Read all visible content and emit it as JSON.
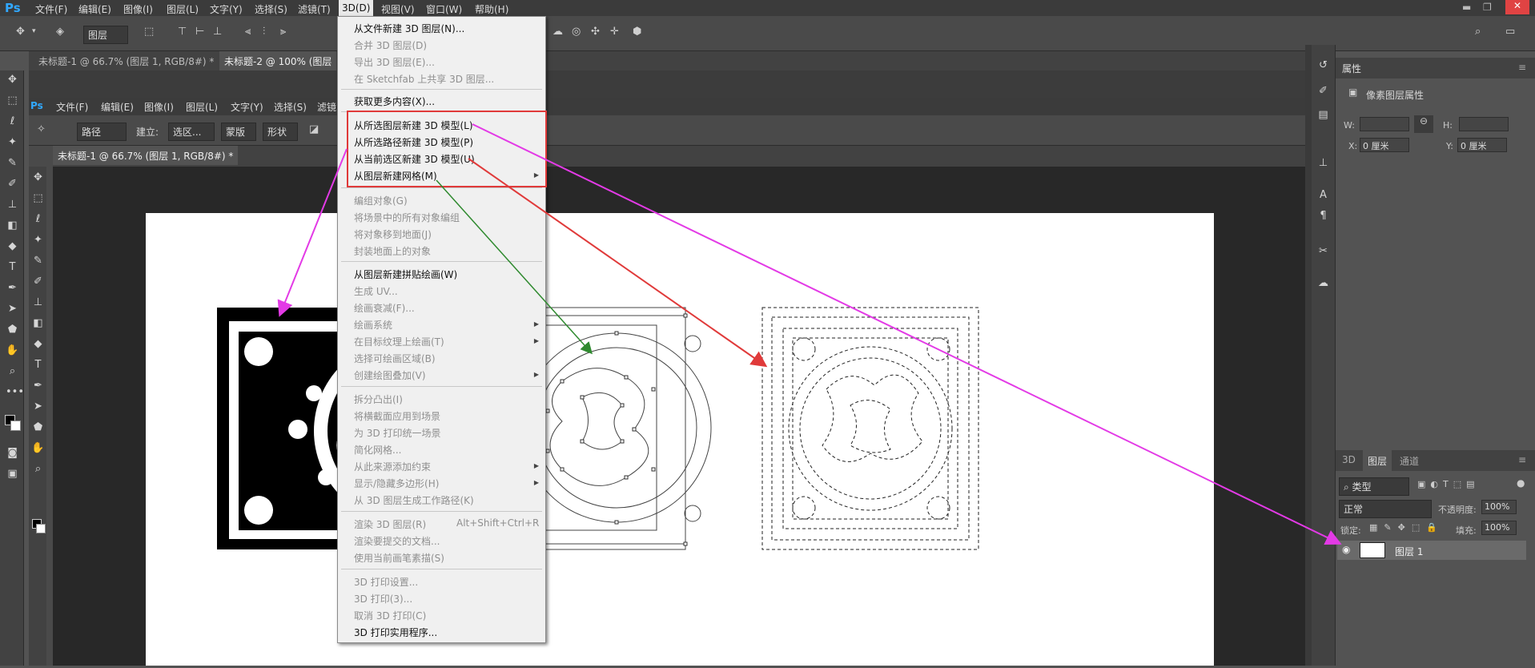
{
  "app": {
    "logo": "Ps"
  },
  "menubar": {
    "items": [
      "文件(F)",
      "编辑(E)",
      "图像(I)",
      "图层(L)",
      "文字(Y)",
      "选择(S)",
      "滤镜(T)",
      "3D(D)",
      "视图(V)",
      "窗口(W)",
      "帮助(H)"
    ],
    "active": "3D(D)"
  },
  "optbar": {
    "mode_select": "图层"
  },
  "tabs": [
    "未标题-1 @ 66.7% (图层 1, RGB/8#) *",
    "未标题-2 @ 100% (图层"
  ],
  "inner": {
    "menubar": [
      "文件(F)",
      "编辑(E)",
      "图像(I)",
      "图层(L)",
      "文字(Y)",
      "选择(S)",
      "滤镜"
    ],
    "optbar": {
      "path_select": "路径",
      "build_label": "建立:",
      "selection_btn": "选区...",
      "mask_btn": "蒙版",
      "shape_btn": "形状"
    },
    "tab": "未标题-1 @ 66.7% (图层 1, RGB/8#) *"
  },
  "dropdown": {
    "items": [
      {
        "label": "从文件新建 3D 图层(N)...",
        "enabled": true
      },
      {
        "label": "合并 3D 图层(D)",
        "enabled": false
      },
      {
        "label": "导出 3D 图层(E)...",
        "enabled": false
      },
      {
        "label": "在 Sketchfab 上共享 3D 图层...",
        "enabled": false
      },
      {
        "label": "获取更多内容(X)...",
        "enabled": true
      },
      {
        "label": "从所选图层新建 3D 模型(L)",
        "enabled": true
      },
      {
        "label": "从所选路径新建 3D 模型(P)",
        "enabled": true
      },
      {
        "label": "从当前选区新建 3D 模型(U)",
        "enabled": true
      },
      {
        "label": "从图层新建网格(M)",
        "enabled": true
      },
      {
        "label": "编组对象(G)",
        "enabled": false
      },
      {
        "label": "将场景中的所有对象编组",
        "enabled": false
      },
      {
        "label": "将对象移到地面(J)",
        "enabled": false
      },
      {
        "label": "封装地面上的对象",
        "enabled": false
      },
      {
        "label": "从图层新建拼贴绘画(W)",
        "enabled": true
      },
      {
        "label": "生成 UV...",
        "enabled": false
      },
      {
        "label": "绘画衰减(F)...",
        "enabled": false
      },
      {
        "label": "绘画系统",
        "enabled": false
      },
      {
        "label": "在目标纹理上绘画(T)",
        "enabled": false
      },
      {
        "label": "选择可绘画区域(B)",
        "enabled": false
      },
      {
        "label": "创建绘图叠加(V)",
        "enabled": false
      },
      {
        "label": "拆分凸出(I)",
        "enabled": false
      },
      {
        "label": "将横截面应用到场景",
        "enabled": false
      },
      {
        "label": "为 3D 打印统一场景",
        "enabled": false
      },
      {
        "label": "简化网格...",
        "enabled": false
      },
      {
        "label": "从此来源添加约束",
        "enabled": false
      },
      {
        "label": "显示/隐藏多边形(H)",
        "enabled": false
      },
      {
        "label": "从 3D 图层生成工作路径(K)",
        "enabled": false
      },
      {
        "label": "渲染 3D 图层(R)",
        "shortcut": "Alt+Shift+Ctrl+R",
        "enabled": false
      },
      {
        "label": "渲染要提交的文档...",
        "enabled": false
      },
      {
        "label": "使用当前画笔素描(S)",
        "enabled": false
      },
      {
        "label": "3D 打印设置...",
        "enabled": false
      },
      {
        "label": "3D 打印(3)...",
        "enabled": false
      },
      {
        "label": "取消 3D 打印(C)",
        "enabled": false
      },
      {
        "label": "3D 打印实用程序...",
        "enabled": true
      }
    ]
  },
  "properties": {
    "title": "属性",
    "subtitle": "像素图层属性",
    "w_label": "W:",
    "h_label": "H:",
    "x_label": "X:",
    "x_value": "0 厘米",
    "y_label": "Y:",
    "y_value": "0 厘米"
  },
  "layers": {
    "tabs": [
      "3D",
      "图层",
      "通道"
    ],
    "filter": "类型",
    "blend": "正常",
    "opacity_label": "不透明度:",
    "opacity": "100%",
    "lock_label": "锁定:",
    "fill_label": "填充:",
    "fill": "100%",
    "layer_name": "图层 1"
  },
  "colors": {
    "highlight": "#e03a3a",
    "arrow_magenta": "#e33ae6",
    "arrow_green": "#2f8a2f",
    "arrow_red": "#e03a3a"
  }
}
